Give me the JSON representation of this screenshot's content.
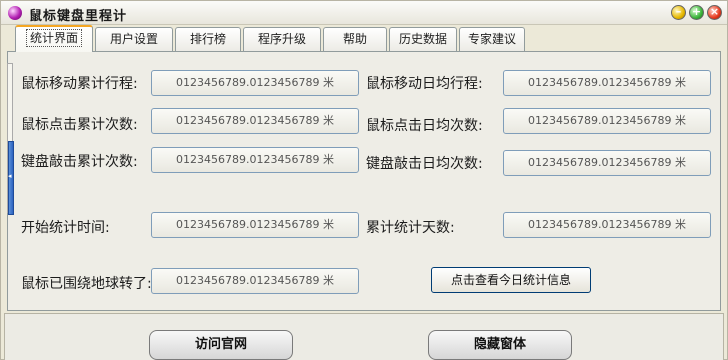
{
  "window": {
    "title": "鼠标键盘里程计"
  },
  "tabs": [
    {
      "label": "统计界面",
      "active": true
    },
    {
      "label": "用户设置"
    },
    {
      "label": "排行榜"
    },
    {
      "label": "程序升级"
    },
    {
      "label": "帮助"
    },
    {
      "label": "历史数据"
    },
    {
      "label": "专家建议"
    }
  ],
  "stats": {
    "mouse_total_distance": {
      "label": "鼠标移动累计行程:",
      "value": "0123456789.0123456789 米"
    },
    "mouse_daily_distance": {
      "label": "鼠标移动日均行程:",
      "value": "0123456789.0123456789 米"
    },
    "click_total": {
      "label": "鼠标点击累计次数:",
      "value": "0123456789.0123456789 米"
    },
    "click_daily": {
      "label": "鼠标点击日均次数:",
      "value": "0123456789.0123456789 米"
    },
    "key_total": {
      "label": "键盘敲击累计次数:",
      "value": "0123456789.0123456789 米"
    },
    "key_daily": {
      "label": "键盘敲击日均次数:",
      "value": "0123456789.0123456789 米"
    },
    "start_time": {
      "label": "开始统计时间:",
      "value": "0123456789.0123456789 米"
    },
    "total_days": {
      "label": "累计统计天数:",
      "value": "0123456789.0123456789 米"
    },
    "earth_laps": {
      "label": "鼠标已围绕地球转了:",
      "value": "0123456789.0123456789 米"
    }
  },
  "buttons": {
    "today_stats": "点击查看今日统计信息",
    "visit_site": "访问官网",
    "hide_window": "隐藏窗体"
  },
  "colors": {
    "active_tab_accent": "#f5a623",
    "field_border": "#7f9db9",
    "side_handle": "#2c63c0"
  }
}
